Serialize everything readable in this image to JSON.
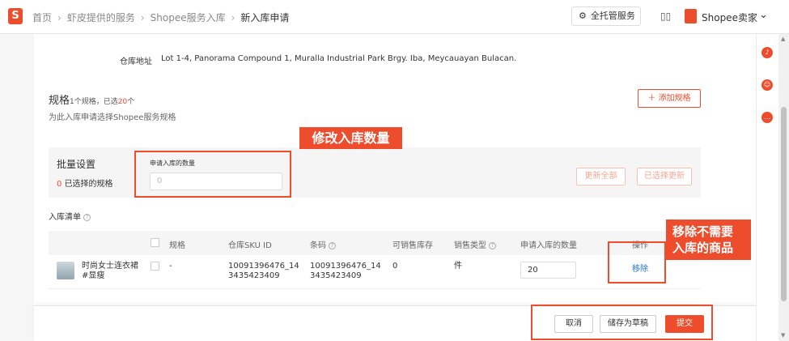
{
  "header": {
    "logo_letter": "S",
    "breadcrumbs": [
      "首页",
      "虾皮提供的服务",
      "Shopee服务入库",
      "新入库申请"
    ],
    "breadcrumb_sep": "›",
    "managed_service_label": "全托管服务",
    "seller_name": "Shopee卖家",
    "chevron": "⌄"
  },
  "warehouse": {
    "label": "仓库地址",
    "address": "Lot 1-4, Panorama Compound 1, Muralla Industrial Park Brgy. Iba, Meycauayan Bulacan."
  },
  "spec": {
    "title": "规格",
    "count_prefix": "1个规格，已选",
    "count_selected": "20",
    "count_suffix": "个",
    "description": "为此入库申请选择Shopee服务规格",
    "add_button": "＋ 添加规格"
  },
  "annotations": {
    "edit_qty": "修改入库数量",
    "remove_line1": "移除不需要",
    "remove_line2": "入库的商品"
  },
  "bulk": {
    "title": "批量设置",
    "selected_count": "0",
    "selected_text": "已选择的规格",
    "qty_label": "申请入库的数量",
    "qty_placeholder": "0",
    "update_all": "更新全部",
    "update_selected": "已选择更新"
  },
  "list": {
    "title": "入库清单",
    "columns": [
      "规格",
      "仓库SKU ID",
      "条码",
      "可销售库存",
      "销售类型",
      "申请入库的数量",
      "操作"
    ],
    "rows": [
      {
        "product_name": "时尚女士连衣裙#显瘦",
        "spec": "-",
        "sku_id": "10091396476_143435423409",
        "barcode": "10091396476_143435423409",
        "sellable_stock": "0",
        "sale_type": "件",
        "qty": "20",
        "action": "移除"
      }
    ]
  },
  "footer": {
    "cancel": "取消",
    "save_draft": "储存为草稿",
    "submit": "提交"
  },
  "colors": {
    "brand": "#ee4d2d",
    "link": "#2673dd"
  }
}
